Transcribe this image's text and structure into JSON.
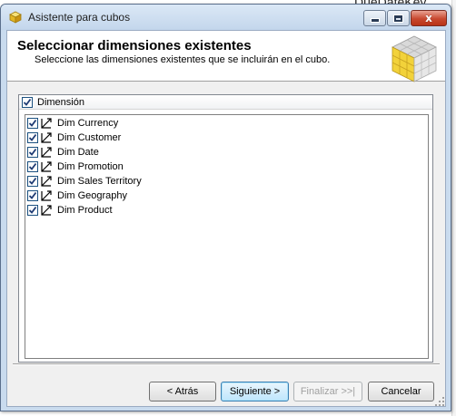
{
  "background": {
    "cut_text": "DueDateKey"
  },
  "window": {
    "title": "Asistente para cubos",
    "close_glyph": "x"
  },
  "header": {
    "title": "Seleccionar dimensiones existentes",
    "subtitle": "Seleccione las dimensiones existentes que se incluirán en el cubo."
  },
  "list": {
    "header_label": "Dimensión",
    "header_checked": true,
    "items": [
      {
        "label": "Dim Currency",
        "checked": true
      },
      {
        "label": "Dim Customer",
        "checked": true
      },
      {
        "label": "Dim Date",
        "checked": true
      },
      {
        "label": "Dim Promotion",
        "checked": true
      },
      {
        "label": "Dim Sales Territory",
        "checked": true
      },
      {
        "label": "Dim Geography",
        "checked": true
      },
      {
        "label": "Dim Product",
        "checked": true
      }
    ]
  },
  "buttons": {
    "back": "< Atrás",
    "next": "Siguiente >",
    "finish": "Finalizar >>|",
    "cancel": "Cancelar"
  },
  "colors": {
    "accent": "#1c5180",
    "window_frame": "#c9dbee",
    "close_button": "#c8482f",
    "cube_yellow": "#f2d23a"
  },
  "icons": {
    "title": "cube-icon",
    "header": "cube-wizard-graphic",
    "dimension": "dimension-icon",
    "check": "check-icon"
  }
}
